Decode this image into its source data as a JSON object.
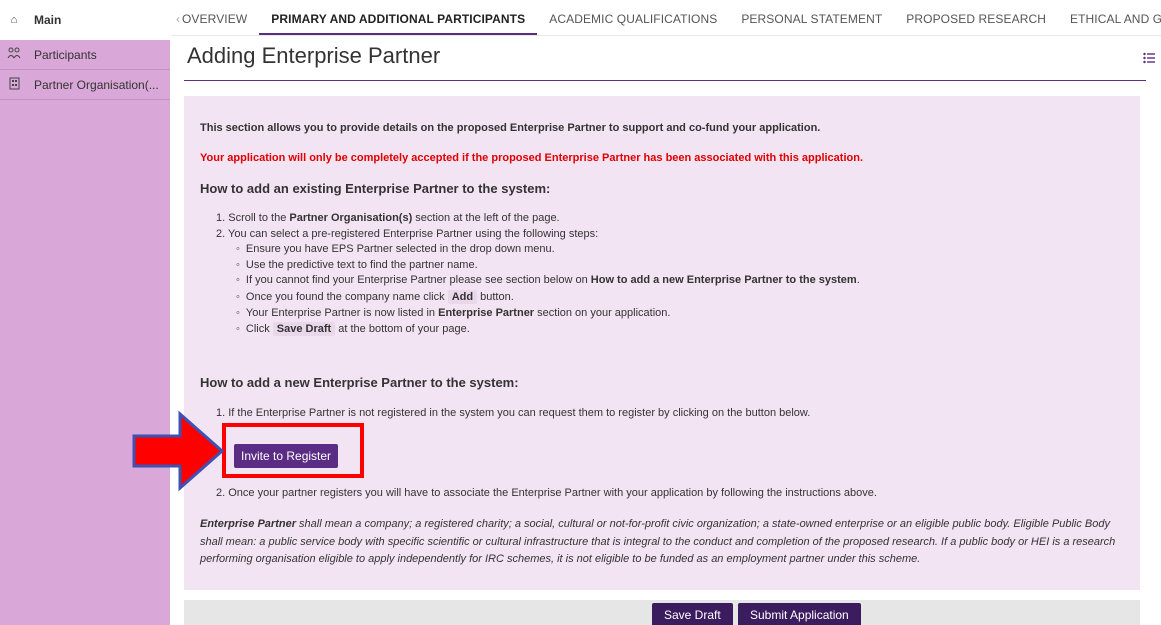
{
  "sidebar": {
    "main_label": "Main",
    "main_icon": "home-icon",
    "items": [
      {
        "label": "Participants",
        "icon": "people-icon"
      },
      {
        "label": "Partner Organisation(...",
        "icon": "building-icon"
      }
    ]
  },
  "tabs": [
    {
      "label": "OVERVIEW",
      "active": false
    },
    {
      "label": "PRIMARY AND ADDITIONAL PARTICIPANTS",
      "active": true
    },
    {
      "label": "ACADEMIC QUALIFICATIONS",
      "active": false
    },
    {
      "label": "PERSONAL STATEMENT",
      "active": false
    },
    {
      "label": "PROPOSED RESEARCH",
      "active": false
    },
    {
      "label": "ETHICAL AND GENDER S",
      "active": false
    }
  ],
  "page": {
    "title": "Adding Enterprise Partner"
  },
  "content": {
    "intro": "This section allows you to provide details on the proposed Enterprise Partner to support and co-fund your application.",
    "warning": "Your application will only be completely accepted if the proposed Enterprise Partner has been associated with this application.",
    "existing_heading": "How to add an existing Enterprise Partner to the system:",
    "step1_pre": "Scroll to the ",
    "step1_bold": "Partner Organisation(s)",
    "step1_post": " section at the left of the page.",
    "step2": "You can select a pre-registered Enterprise Partner using the following steps:",
    "sub1": "Ensure you have EPS Partner selected in the drop down menu.",
    "sub2": "Use the predictive text to find the partner name.",
    "sub3_pre": "If you cannot find your Enterprise Partner please see section below on ",
    "sub3_bold": "How to add a new Enterprise Partner to the system",
    "sub3_post": ".",
    "sub4_pre": "Once you found the company name click ",
    "sub4_chip": "Add",
    "sub4_post": " button.",
    "sub5_pre": "Your Enterprise Partner is now listed in ",
    "sub5_bold": "Enterprise Partner",
    "sub5_post": " section on your application.",
    "sub6_pre": "Click ",
    "sub6_chip": "Save Draft",
    "sub6_post": " at the bottom of your page.",
    "new_heading": "How to add a new Enterprise Partner to the system:",
    "new_step1": "1. If the Enterprise Partner is not registered in the system you can request them to register by clicking on the button below.",
    "invite_button": "Invite to Register",
    "new_step2": "2. Once your partner registers you will have to associate the Enterprise Partner with your application by following the instructions above.",
    "note_bold": "Enterprise Partner",
    "note_text": " shall mean a company; a registered charity; a social, cultural or not-for-profit civic organization; a state-owned enterprise or an eligible public body. Eligible Public Body shall mean: a public service body with specific scientific or cultural infrastructure that is integral to the conduct and completion of the proposed research. If a public body or HEI is a research performing organisation eligible to apply independently for IRC schemes, it is not eligible to be funded as an employment partner under this scheme."
  },
  "footer": {
    "save_draft": "Save Draft",
    "submit": "Submit Application"
  },
  "colors": {
    "brand_purple": "#5b2c83",
    "sidebar_bg": "#d9a8d8",
    "panel_bg": "#f3e4f3",
    "warning_red": "#e00000",
    "annotation_red": "#ff0000",
    "annotation_arrow_outline": "#3f51b5"
  }
}
